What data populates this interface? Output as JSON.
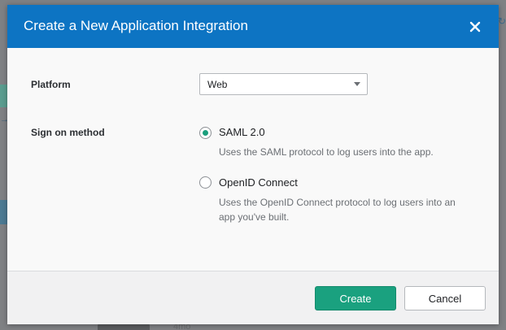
{
  "background": {
    "partial_text": "4mo"
  },
  "modal": {
    "title": "Create a New Application Integration",
    "header_color": "#0d74c3",
    "close_icon": "close-icon"
  },
  "platform": {
    "label": "Platform",
    "selected": "Web"
  },
  "sign_on": {
    "label": "Sign on method",
    "options": [
      {
        "label": "SAML 2.0",
        "description": "Uses the SAML protocol to log users into the app.",
        "selected": true
      },
      {
        "label": "OpenID Connect",
        "description": "Uses the OpenID Connect protocol to log users into an app you've built.",
        "selected": false
      }
    ]
  },
  "footer": {
    "create_label": "Create",
    "cancel_label": "Cancel",
    "accent_color": "#1aa17f"
  }
}
